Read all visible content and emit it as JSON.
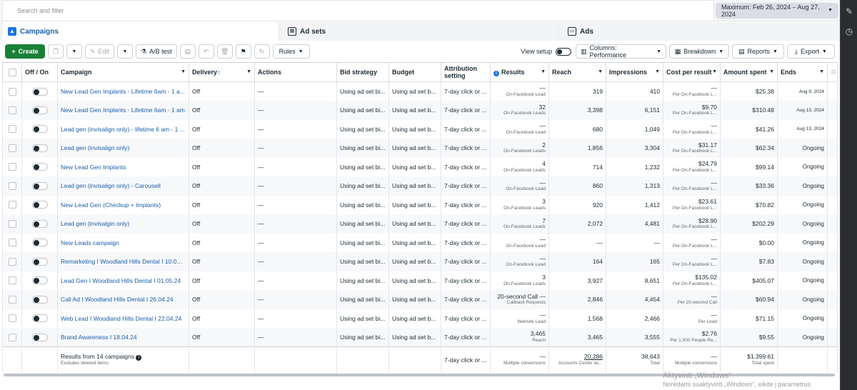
{
  "search": {
    "placeholder": "Search and filter"
  },
  "date_range": "Maximum: Feb 26, 2024 – Aug 27, 2024",
  "tabs": [
    {
      "label": "Campaigns",
      "active": true
    },
    {
      "label": "Ad sets",
      "active": false
    },
    {
      "label": "Ads",
      "active": false
    }
  ],
  "toolbar": {
    "create": "Create",
    "edit": "Edit",
    "ab_test": "A/B test",
    "rules": "Rules",
    "view_setup": "View setup",
    "columns": "Columns: Performance",
    "breakdown": "Breakdown",
    "reports": "Reports",
    "export": "Export"
  },
  "columns": {
    "off_on": "Off / On",
    "campaign": "Campaign",
    "delivery": "Delivery",
    "actions": "Actions",
    "bid_strategy": "Bid strategy",
    "budget": "Budget",
    "attribution": "Attribution setting",
    "results": "Results",
    "reach": "Reach",
    "impressions": "Impressions",
    "cost_per_result": "Cost per result",
    "amount_spent": "Amount spent",
    "ends": "Ends"
  },
  "rows": [
    {
      "campaign": "New Lead Gen Implants - Lifetime 6am - 1 a...",
      "delivery": "Off",
      "actions": "—",
      "bid": "Using ad set bi...",
      "budget": "Using ad set b...",
      "attribution": "7-day click or ...",
      "results": "—",
      "results_sub": "On-Facebook Lead",
      "reach": "319",
      "impressions": "410",
      "cpr": "—",
      "cpr_sub": "Per On-Facebook L...",
      "spent": "$25.38",
      "ends": "Aug 9, 2024"
    },
    {
      "campaign": "New Lead Gen Implants - Lifetime 6am - 1 am",
      "delivery": "Off",
      "actions": "—",
      "bid": "Using ad set bi...",
      "budget": "Using ad set b...",
      "attribution": "7-day click or ...",
      "results": "32",
      "results_sub": "On-Facebook Leads",
      "reach": "3,398",
      "impressions": "6,151",
      "cpr": "$9.70",
      "cpr_sub": "Per On-Facebook L...",
      "spent": "$310.48",
      "ends": "Aug 13, 2024"
    },
    {
      "campaign": "Lead gen (invisalign only) - lifetime 6 am - 1 ...",
      "delivery": "Off",
      "actions": "—",
      "bid": "Using ad set bi...",
      "budget": "Using ad set b...",
      "attribution": "7-day click or ...",
      "results": "—",
      "results_sub": "On-Facebook Lead",
      "reach": "680",
      "impressions": "1,049",
      "cpr": "—",
      "cpr_sub": "Per On-Facebook L...",
      "spent": "$41.26",
      "ends": "Aug 13, 2024"
    },
    {
      "campaign": "Lead gen (invisalign only)",
      "delivery": "Off",
      "actions": "—",
      "bid": "Using ad set bi...",
      "budget": "Using ad set b...",
      "attribution": "7-day click or ...",
      "results": "2",
      "results_sub": "On-Facebook Leads",
      "reach": "1,856",
      "impressions": "3,304",
      "cpr": "$31.17",
      "cpr_sub": "Per On-Facebook L...",
      "spent": "$62.34",
      "ends": "Ongoing"
    },
    {
      "campaign": "New Lead Gen Implants",
      "delivery": "Off",
      "actions": "—",
      "bid": "Using ad set bi...",
      "budget": "Using ad set b...",
      "attribution": "7-day click or ...",
      "results": "4",
      "results_sub": "On-Facebook Leads",
      "reach": "714",
      "impressions": "1,232",
      "cpr": "$24.79",
      "cpr_sub": "Per On-Facebook L...",
      "spent": "$99.14",
      "ends": "Ongoing"
    },
    {
      "campaign": "Lead gen (invisalign only) - Carousell",
      "delivery": "Off",
      "actions": "—",
      "bid": "Using ad set bi...",
      "budget": "Using ad set b...",
      "attribution": "7-day click or ...",
      "results": "—",
      "results_sub": "On-Facebook Lead",
      "reach": "860",
      "impressions": "1,313",
      "cpr": "—",
      "cpr_sub": "Per On-Facebook L...",
      "spent": "$33.36",
      "ends": "Ongoing"
    },
    {
      "campaign": "New Lead Gen (Checkup + Implants)",
      "delivery": "Off",
      "actions": "—",
      "bid": "Using ad set bi...",
      "budget": "Using ad set b...",
      "attribution": "7-day click or ...",
      "results": "3",
      "results_sub": "On-Facebook Leads",
      "reach": "920",
      "impressions": "1,412",
      "cpr": "$23.61",
      "cpr_sub": "Per On-Facebook L...",
      "spent": "$70.82",
      "ends": "Ongoing"
    },
    {
      "campaign": "Lead gen (invisalgin only)",
      "delivery": "Off",
      "actions": "—",
      "bid": "Using ad set bi...",
      "budget": "Using ad set b...",
      "attribution": "7-day click or ...",
      "results": "7",
      "results_sub": "On-Facebook Leads",
      "reach": "2,072",
      "impressions": "4,481",
      "cpr": "$28.90",
      "cpr_sub": "Per On-Facebook L...",
      "spent": "$202.29",
      "ends": "Ongoing"
    },
    {
      "campaign": "New Leads campaign",
      "delivery": "Off",
      "actions": "—",
      "bid": "Using ad set bi...",
      "budget": "Using ad set b...",
      "attribution": "7-day click or ...",
      "results": "—",
      "results_sub": "On-Facebook Lead",
      "reach": "—",
      "impressions": "—",
      "cpr": "—",
      "cpr_sub": "Per On-Facebook L...",
      "spent": "$0.00",
      "ends": "Ongoing"
    },
    {
      "campaign": "Remarketing I Woodland Hills Dental I 10.05....",
      "delivery": "Off",
      "actions": "—",
      "bid": "Using ad set bi...",
      "budget": "Using ad set b...",
      "attribution": "7-day click or ...",
      "results": "—",
      "results_sub": "On-Facebook Lead",
      "reach": "164",
      "impressions": "165",
      "cpr": "—",
      "cpr_sub": "Per On-Facebook L...",
      "spent": "$7.83",
      "ends": "Ongoing"
    },
    {
      "campaign": "Lead Gen I Woodland Hills Dental I 01.05.24",
      "delivery": "Off",
      "actions": "—",
      "bid": "Using ad set bi...",
      "budget": "Using ad set b...",
      "attribution": "7-day click or ...",
      "results": "3",
      "results_sub": "On-Facebook Leads",
      "reach": "3,927",
      "impressions": "8,651",
      "cpr": "$135.02",
      "cpr_sub": "Per On-Facebook L...",
      "spent": "$405.07",
      "ends": "Ongoing"
    },
    {
      "campaign": "Call Ad I Woodland Hills Dental I 26.04.24",
      "delivery": "Off",
      "actions": "—",
      "bid": "Using ad set bi...",
      "budget": "Using ad set b...",
      "attribution": "7-day click or ...",
      "results": "20-second Call  —",
      "results_sub": "Callback Requests",
      "reach": "2,846",
      "impressions": "4,454",
      "cpr": "—",
      "cpr_sub": "Per 20-second Call",
      "spent": "$60.94",
      "ends": "Ongoing"
    },
    {
      "campaign": "Web Lead I Woodland Hills Dental I 22.04.24",
      "delivery": "Off",
      "actions": "—",
      "bid": "Using ad set bi...",
      "budget": "Using ad set b...",
      "attribution": "7-day click or ...",
      "results": "—",
      "results_sub": "Website Lead",
      "reach": "1,568",
      "impressions": "2,466",
      "cpr": "—",
      "cpr_sub": "Per Lead",
      "spent": "$71.15",
      "ends": "Ongoing"
    },
    {
      "campaign": "Brand Awareness I 18.04.24",
      "delivery": "Off",
      "actions": "—",
      "bid": "Using ad set bi...",
      "budget": "Using ad set b...",
      "attribution": "7-day click or ...",
      "results": "3,465",
      "results_sub": "Reach",
      "reach": "3,465",
      "impressions": "3,555",
      "cpr": "$2.76",
      "cpr_sub": "Per 1,000 People Re...",
      "spent": "$9.55",
      "ends": "Ongoing"
    }
  ],
  "footer": {
    "label": "Results from 14 campaigns",
    "sub": "Excludes deleted items",
    "attribution": "7-day click or ...",
    "results": "—",
    "results_sub": "Multiple conversions",
    "reach": "20,286",
    "reach_sub": "Accounts Center ac...",
    "impressions": "38,643",
    "impressions_sub": "Total",
    "cpr": "—",
    "cpr_sub": "Multiple conversions",
    "spent": "$1,399.61",
    "spent_sub": "Total spent"
  },
  "watermark": {
    "line1": "Aktyvinti „Windows“",
    "line2": "Norėdami suaktyvinti „Windows“, eikite į parametrus"
  }
}
